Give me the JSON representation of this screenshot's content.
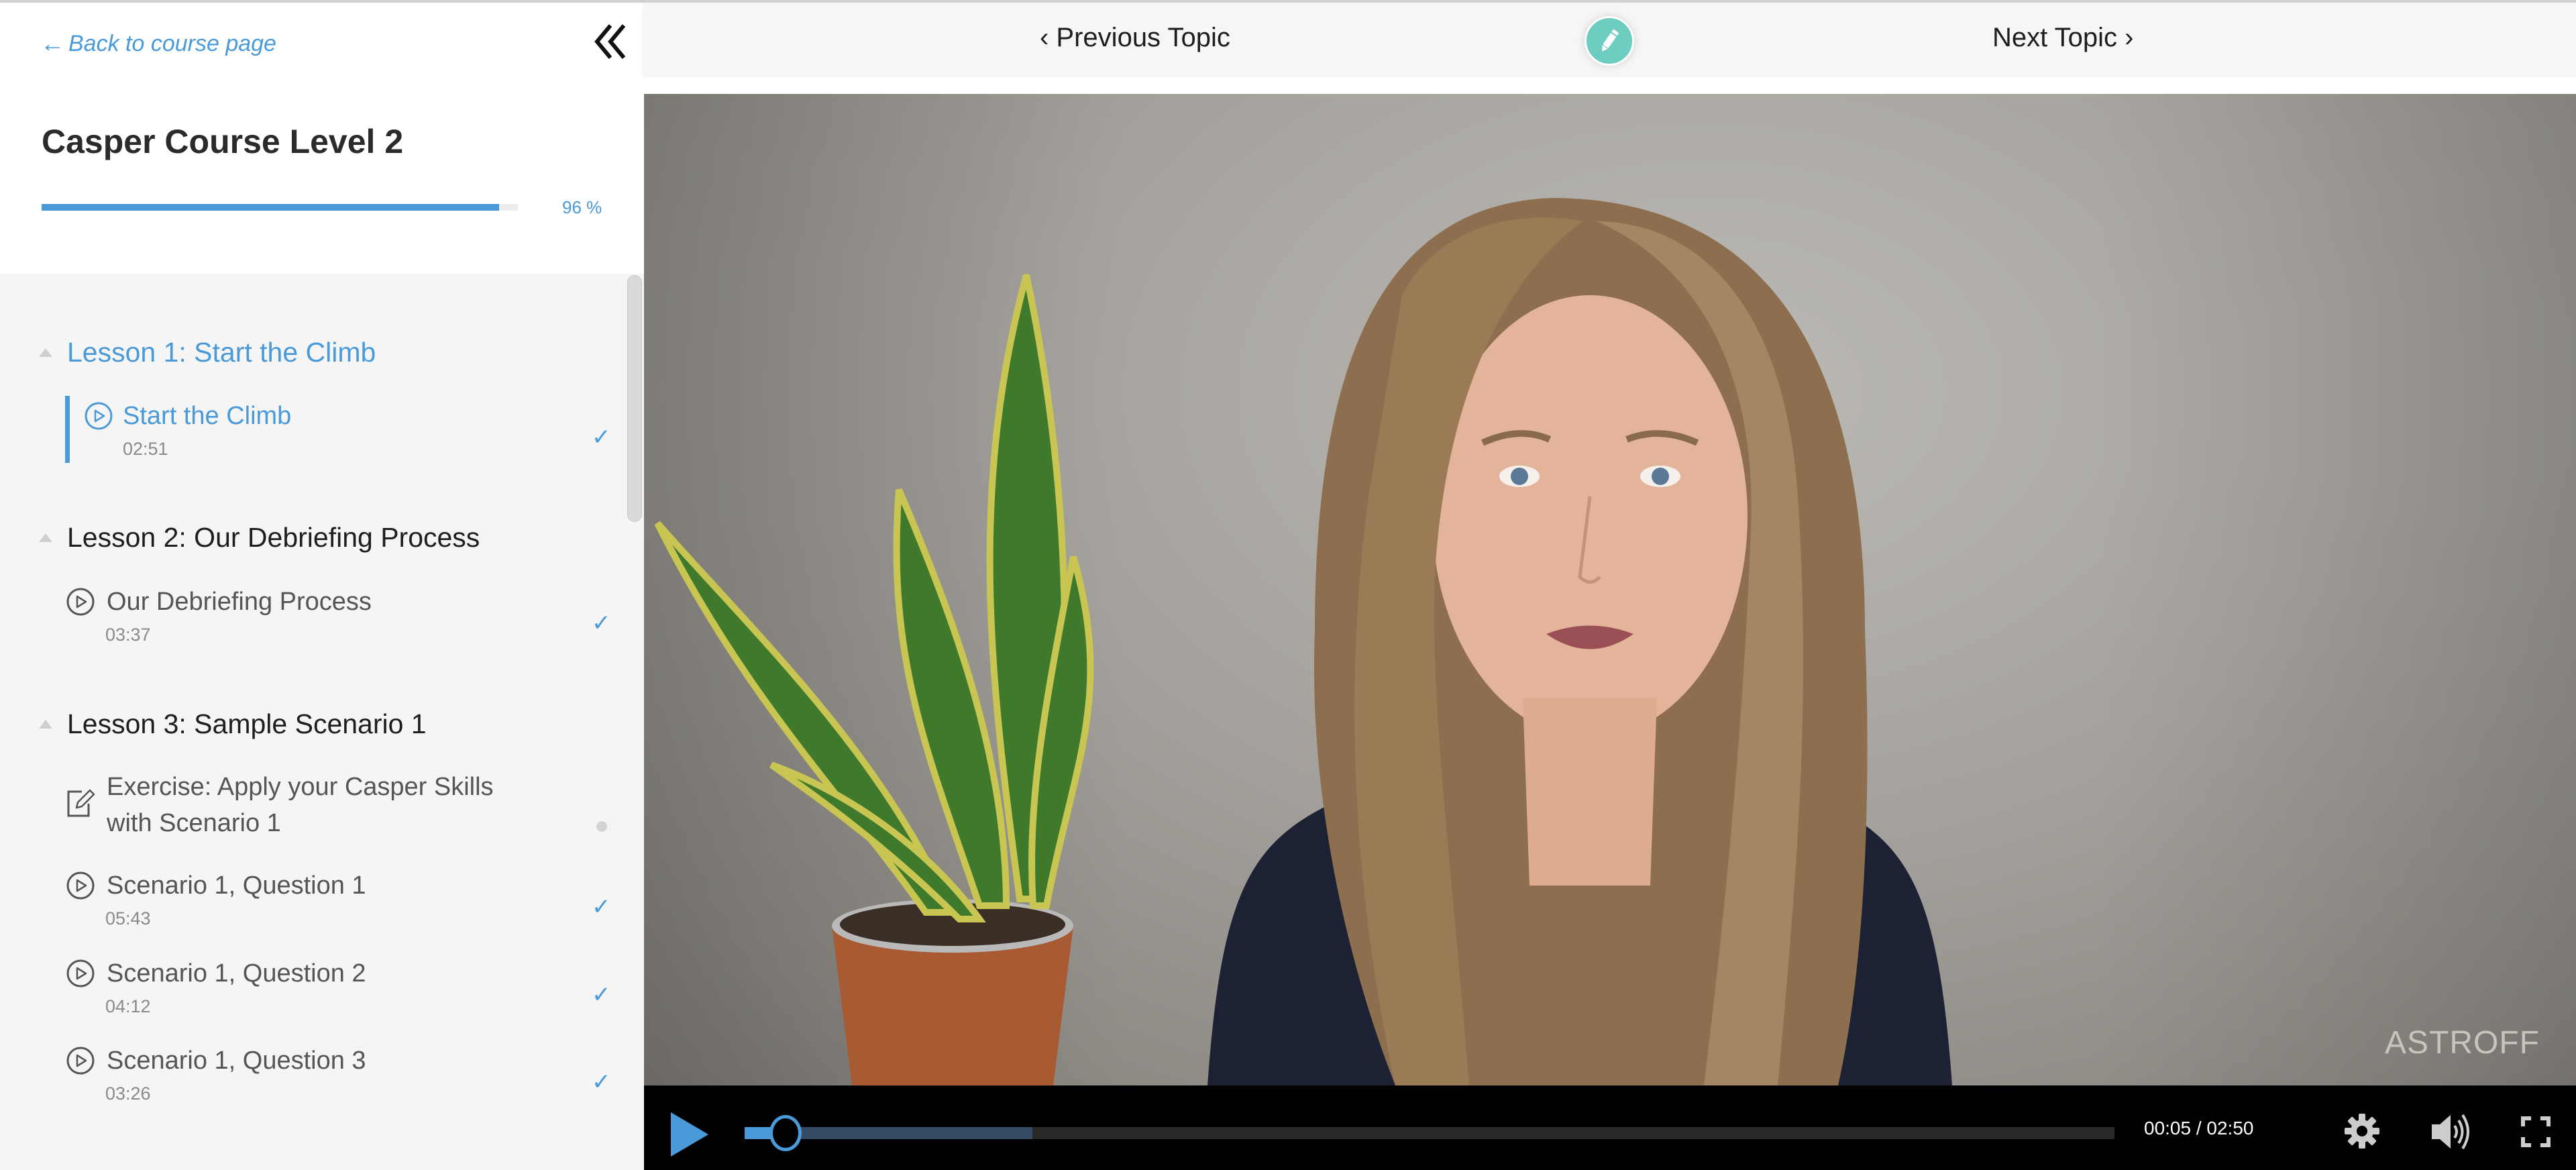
{
  "sidebar": {
    "back_link": "Back to course page",
    "back_arrow_icon": "arrow-left-icon",
    "collapse_icon": "double-chevron-left-icon",
    "course_title": "Casper Course Level 2",
    "progress": {
      "percent": 96,
      "label": "96 %"
    },
    "lessons": [
      {
        "title": "Lesson 1: Start the Climb",
        "expanded": true,
        "active": true,
        "topics": [
          {
            "title": "Start the Climb",
            "type": "video",
            "duration": "02:51",
            "status": "complete",
            "active": true
          }
        ]
      },
      {
        "title": "Lesson 2: Our Debriefing Process",
        "expanded": true,
        "active": false,
        "topics": [
          {
            "title": "Our Debriefing Process",
            "type": "video",
            "duration": "03:37",
            "status": "complete",
            "active": false
          }
        ]
      },
      {
        "title": "Lesson 3: Sample Scenario 1",
        "expanded": true,
        "active": false,
        "topics": [
          {
            "title_line1": "Exercise: Apply your Casper Skills",
            "title_line2": "with Scenario 1",
            "type": "exercise",
            "status": "incomplete",
            "active": false
          },
          {
            "title": "Scenario 1, Question 1",
            "type": "video",
            "duration": "05:43",
            "status": "complete",
            "active": false
          },
          {
            "title": "Scenario 1, Question 2",
            "type": "video",
            "duration": "04:12",
            "status": "complete",
            "active": false
          },
          {
            "title": "Scenario 1, Question 3",
            "type": "video",
            "duration": "03:26",
            "status": "complete",
            "active": false
          }
        ]
      }
    ],
    "check_glyph": "✓"
  },
  "topnav": {
    "prev_label": "‹ Previous Topic",
    "next_label": "Next Topic ›",
    "edit_icon": "pencil-icon"
  },
  "video": {
    "watermark": "ASTROFF",
    "current_time": "00:05",
    "duration": "02:50",
    "time_readout": "00:05 / 02:50",
    "played_fraction": 0.03,
    "buffered_fraction": 0.21
  },
  "colors": {
    "accent": "#4a9ad9",
    "edit_button": "#6ccdc0",
    "buffer": "#344b62",
    "track": "#282828"
  }
}
